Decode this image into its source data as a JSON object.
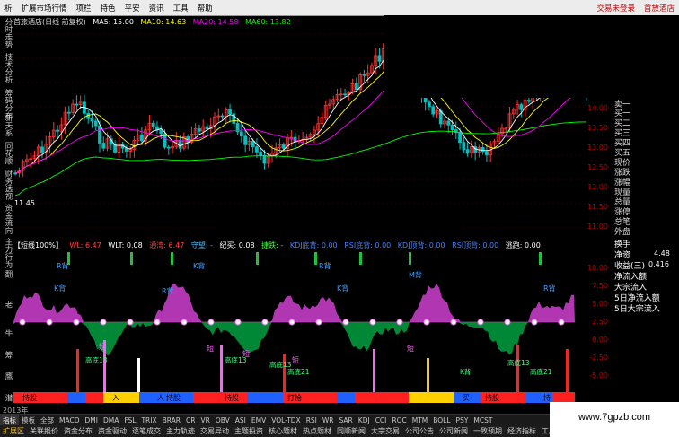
{
  "colors": {
    "up": "#ff3333",
    "down": "#00c0c0",
    "ma5": "#ffffff",
    "ma10": "#ffff00",
    "ma20": "#ff00ff",
    "ma60": "#00ff00",
    "accent": "#c00000",
    "magenta": "#d040d0",
    "green": "#00a040"
  },
  "menu": {
    "items": [
      "析",
      "扩展市场行情",
      "项栏",
      "特色",
      "平安",
      "资讯",
      "工具",
      "帮助"
    ],
    "right_items": [
      "交易未登录",
      "首放酒店"
    ]
  },
  "sidetabs": [
    "分时走势",
    "技术分析",
    "筹码分布",
    "新天系",
    "同花顺",
    "财务透视",
    "资金流向",
    "主力行为"
  ],
  "sidetabs2": [
    "翻",
    "老",
    "牛",
    "筹",
    "鹰",
    "潜"
  ],
  "chart_header": {
    "title": "首旅酒店(日线 前复权)",
    "ma5": "MA5: 15.00",
    "ma10": "MA10: 14.63",
    "ma20": "MA20: 14.58",
    "ma60": "MA60: 13.82"
  },
  "low_marker": "11.45",
  "price_axis": [
    "14.00",
    "13.50",
    "13.00",
    "12.50",
    "12.00",
    "11.50",
    "11.00"
  ],
  "quote_panel": {
    "labels": [
      "卖一",
      "买一",
      "买二",
      "买三",
      "买四",
      "买五",
      "现价",
      "涨跌",
      "涨幅",
      "现量",
      "总量",
      "涨停",
      "总笔",
      "外盘",
      "换手",
      "净资",
      "收益(三)",
      "净流入额",
      "大宗流入",
      "5日净流入额",
      "5日大宗流入"
    ],
    "values": {
      "jingzi": "4.48",
      "shouyi": "0.416"
    }
  },
  "indicator_header": {
    "name": "【短线100%】",
    "wl": "WL: 6.47",
    "wlt": "WLT: 0.08",
    "tongxin": "通湾: 6.47",
    "shouwang": "守望: -",
    "jiyi": "纪买: 0.08",
    "jiexian": "捷跌: -",
    "kdj_di": "KDJ底背: 0.00",
    "rsi_di": "RSI底背: 0.00",
    "kdj_ding": "KDJ顶背: 0.00",
    "rsi_ding": "RSI顶背: 0.00",
    "taopao": "逃跑: 0.00"
  },
  "sub_axis": [
    "10.00",
    "7.50",
    "5.00",
    "2.50",
    "0.00",
    "-2.50",
    "-5.00"
  ],
  "sub_labels": {
    "rbei": [
      "R背",
      "K背",
      "R背",
      "K背",
      "R背",
      "K背",
      "M背",
      "R背"
    ],
    "duan": [
      "短",
      "短",
      "短",
      "短",
      "短"
    ],
    "gaodi": [
      "高底13",
      "高底13",
      "高底21",
      "高底13",
      "高底13",
      "高底21",
      "K背"
    ]
  },
  "strip_labels": [
    "持股",
    "入",
    "持股",
    "持股",
    "打枪",
    "人",
    "买",
    "持股",
    "持"
  ],
  "year": "2013年",
  "tabbar": [
    "指标",
    "模板",
    "全部",
    "MACD",
    "DMI",
    "DMA",
    "FSL",
    "TRIX",
    "BRAR",
    "CR",
    "VR",
    "OBV",
    "ASI",
    "EMV",
    "VOL-TDX",
    "RSI",
    "WR",
    "SAR",
    "KDJ",
    "CCI",
    "ROC",
    "MTM",
    "BOLL",
    "PSY",
    "MCST"
  ],
  "bottombar": [
    "扩展区",
    "关联报价",
    "资金分布",
    "资金驱动",
    "逐笔成交",
    "主力轨迹",
    "交易异动",
    "主题投资",
    "核心题材",
    "热点题材",
    "同顺新闻",
    "大宗交易",
    "公司公告",
    "公司新闻",
    "一致预期",
    "经济指标",
    "工具"
  ],
  "watermark": "www.7gpzb.com"
}
